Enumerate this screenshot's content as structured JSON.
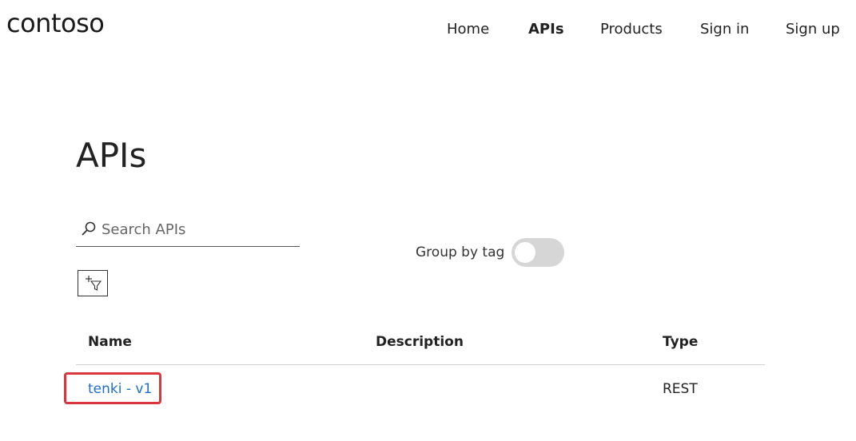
{
  "logo": {
    "text": "contoso"
  },
  "nav": {
    "items": [
      {
        "label": "Home",
        "active": false
      },
      {
        "label": "APIs",
        "active": true
      },
      {
        "label": "Products",
        "active": false
      },
      {
        "label": "Sign in",
        "active": false
      },
      {
        "label": "Sign up",
        "active": false
      }
    ]
  },
  "page": {
    "title": "APIs"
  },
  "search": {
    "placeholder": "Search APIs",
    "value": "",
    "icon": "search-icon"
  },
  "group_by_tag": {
    "label": "Group by tag",
    "enabled": false
  },
  "filter_button": {
    "icon": "add-filter-icon"
  },
  "table": {
    "columns": [
      "Name",
      "Description",
      "Type"
    ],
    "rows": [
      {
        "name": "tenki - v1",
        "description": "",
        "type": "REST"
      }
    ]
  },
  "colors": {
    "link": "#1f6fc5",
    "highlight_border": "#d9363e",
    "toggle_off": "#d6d6d6"
  }
}
